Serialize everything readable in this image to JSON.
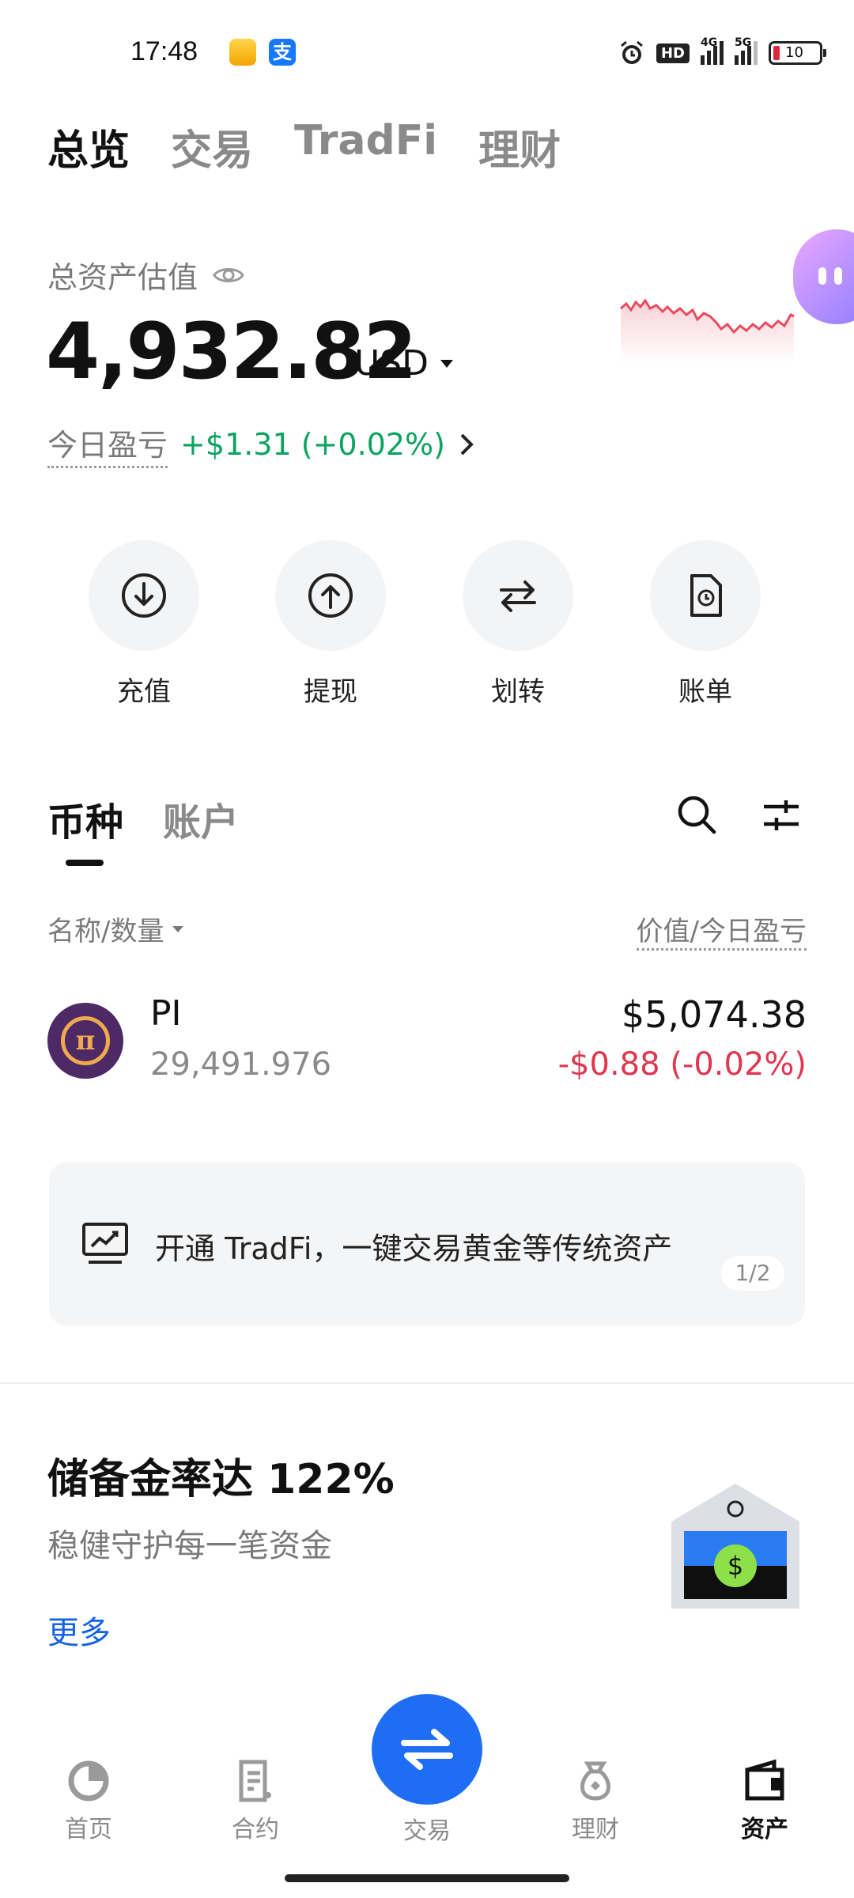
{
  "status_bar": {
    "time": "17:48",
    "pay_glyph": "支",
    "network_1": "4G",
    "network_2": "5G",
    "hd": "HD",
    "battery": "10",
    "icons": [
      "mail-app-icon",
      "alipay-icon",
      "alarm-icon",
      "hd-voice-icon",
      "signal-icon",
      "signal-icon",
      "battery-icon"
    ]
  },
  "top_tabs": [
    "总览",
    "交易",
    "TradFi",
    "理财"
  ],
  "overview": {
    "total_label": "总资产估值",
    "balance": "4,932.82",
    "currency": "USD",
    "today_label": "今日盈亏",
    "today_value": "+$1.31 (+0.02%)",
    "colors": {
      "gain": "#0ba360",
      "loss": "#e0364f",
      "spark": "#e84b5f"
    }
  },
  "actions": [
    {
      "label": "充值",
      "icon": "deposit-icon"
    },
    {
      "label": "提现",
      "icon": "withdraw-icon"
    },
    {
      "label": "划转",
      "icon": "transfer-icon"
    },
    {
      "label": "账单",
      "icon": "bill-icon"
    }
  ],
  "section_tabs": [
    "币种",
    "账户"
  ],
  "columns": {
    "left": "名称/数量",
    "right": "价值/今日盈亏"
  },
  "assets": [
    {
      "symbol": "PI",
      "logo_glyph": "π",
      "quantity": "29,491.976",
      "value": "$5,074.38",
      "pnl": "-$0.88 (-0.02%)"
    }
  ],
  "banner": {
    "text": "开通 TradFi，一键交易黄金等传统资产",
    "page": "1/2"
  },
  "reserve": {
    "title": "储备金率达 122%",
    "subtitle": "稳健守护每一笔资金",
    "more": "更多"
  },
  "bottom_nav": [
    {
      "label": "首页",
      "icon": "home-icon"
    },
    {
      "label": "合约",
      "icon": "contract-icon"
    },
    {
      "label": "交易",
      "icon": "trade-swap-icon"
    },
    {
      "label": "理财",
      "icon": "earn-icon"
    },
    {
      "label": "资产",
      "icon": "wallet-icon",
      "active": true
    }
  ],
  "accent_color": "#1e6ef5"
}
